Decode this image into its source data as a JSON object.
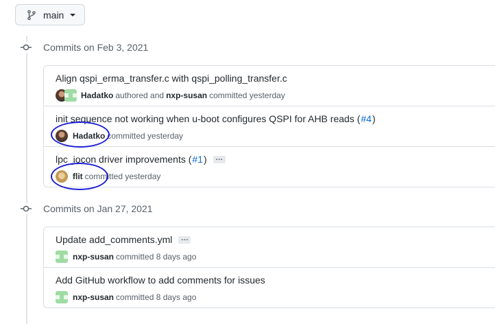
{
  "branch": {
    "name": "main"
  },
  "groups": [
    {
      "title": "Commits on Feb 3, 2021",
      "commits": [
        {
          "message": "Align qspi_erma_transfer.c with qspi_polling_transfer.c",
          "author": "Hadatko",
          "middle": " authored and ",
          "committer": "nxp-susan",
          "time": " committed yesterday"
        },
        {
          "message": "init sequence not working when u-boot configures QSPI for AHB reads (",
          "pr": "#4",
          "message_end": ")",
          "author": "Hadatko",
          "time": " committed yesterday"
        },
        {
          "message": "lpc_iocon driver improvements (",
          "pr": "#1",
          "message_end": ")",
          "ellipsis": "…",
          "author": "flit",
          "time": " committed yesterday"
        }
      ]
    },
    {
      "title": "Commits on Jan 27, 2021",
      "commits": [
        {
          "message": "Update add_comments.yml",
          "ellipsis": "…",
          "author": "nxp-susan",
          "time": " committed 8 days ago"
        },
        {
          "message": "Add GitHub workflow to add comments for issues",
          "author": "nxp-susan",
          "time": " committed 8 days ago"
        }
      ]
    }
  ],
  "colors": {
    "link": "#0969da",
    "annotation": "#1f1fd6"
  }
}
